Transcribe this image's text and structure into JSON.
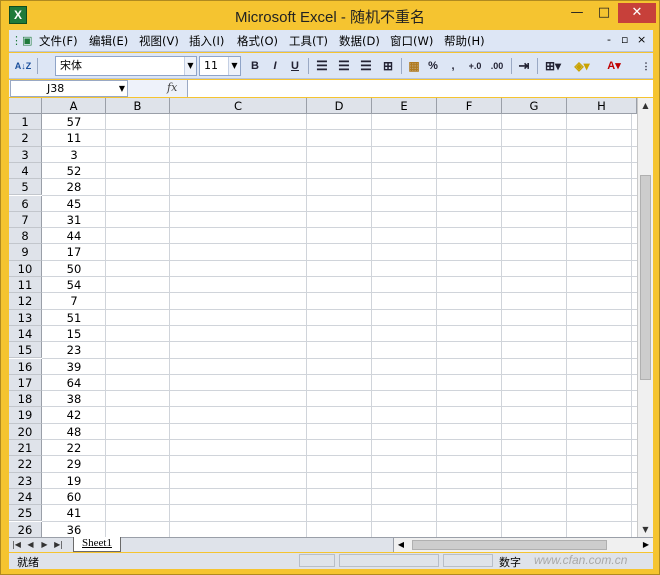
{
  "window": {
    "app_icon": "X",
    "title": "Microsoft Excel - 随机不重名",
    "minimize": "—",
    "maximize": "□",
    "close": "✕"
  },
  "menu": {
    "items": [
      "文件(F)",
      "编辑(E)",
      "视图(V)",
      "插入(I)",
      "格式(O)",
      "工具(T)",
      "数据(D)",
      "窗口(W)",
      "帮助(H)"
    ],
    "right_minimize": "-",
    "right_restore": "▫",
    "right_close": "×"
  },
  "toolbar": {
    "sort_label": "A↓Z",
    "font_name": "宋体",
    "font_size": "11",
    "bold": "B",
    "italic": "I",
    "underline": "U",
    "percent": "%",
    "comma": ",",
    "inc_decimal": "+.0",
    "dec_decimal": ".00",
    "font_color_label": "A"
  },
  "formula_bar": {
    "name_box": "J38",
    "fx_label": "fx",
    "formula": ""
  },
  "columns": [
    "A",
    "B",
    "C",
    "D",
    "E",
    "F",
    "G",
    "H"
  ],
  "rows": [
    {
      "row": "1",
      "a": "57"
    },
    {
      "row": "2",
      "a": "11"
    },
    {
      "row": "3",
      "a": "3"
    },
    {
      "row": "4",
      "a": "52"
    },
    {
      "row": "5",
      "a": "28"
    },
    {
      "row": "6",
      "a": "45"
    },
    {
      "row": "7",
      "a": "31"
    },
    {
      "row": "8",
      "a": "44"
    },
    {
      "row": "9",
      "a": "17"
    },
    {
      "row": "10",
      "a": "50"
    },
    {
      "row": "11",
      "a": "54"
    },
    {
      "row": "12",
      "a": "7"
    },
    {
      "row": "13",
      "a": "51"
    },
    {
      "row": "14",
      "a": "15"
    },
    {
      "row": "15",
      "a": "23"
    },
    {
      "row": "16",
      "a": "39"
    },
    {
      "row": "17",
      "a": "64"
    },
    {
      "row": "18",
      "a": "38"
    },
    {
      "row": "19",
      "a": "42"
    },
    {
      "row": "20",
      "a": "48"
    },
    {
      "row": "21",
      "a": "22"
    },
    {
      "row": "22",
      "a": "29"
    },
    {
      "row": "23",
      "a": "19"
    },
    {
      "row": "24",
      "a": "60"
    },
    {
      "row": "25",
      "a": "41"
    },
    {
      "row": "26",
      "a": "36"
    }
  ],
  "sheet_tabs": {
    "nav": [
      "|◀",
      "◀",
      "▶",
      "▶|"
    ],
    "active": "Sheet1"
  },
  "status": {
    "ready": "就绪",
    "num_mode": "数字"
  },
  "watermark": "www.cfan.com.cn"
}
